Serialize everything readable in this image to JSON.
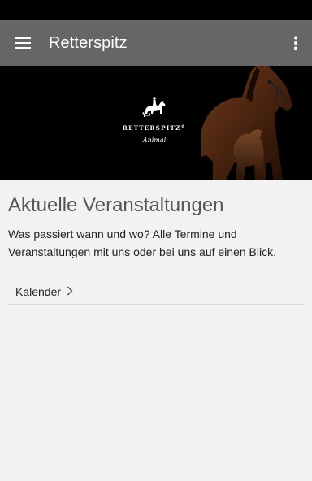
{
  "app_bar": {
    "title": "Retterspitz",
    "menu_icon": "menu-icon",
    "overflow_icon": "more-vert-icon",
    "background": "#666666"
  },
  "hero": {
    "brand_name": "RETTERSPITZ",
    "brand_mark": "®",
    "brand_sub": "Animal",
    "logo_icon": "horse-rider-dog-logo",
    "image": "horse-and-dog-photo"
  },
  "main": {
    "title": "Aktuelle Veranstaltungen",
    "description": "Was passiert wann und wo? Alle Termine und Veranstaltungen mit uns oder bei uns auf einen Blick.",
    "calendar_link": {
      "label": "Kalender",
      "icon": "chevron-right-icon"
    }
  }
}
